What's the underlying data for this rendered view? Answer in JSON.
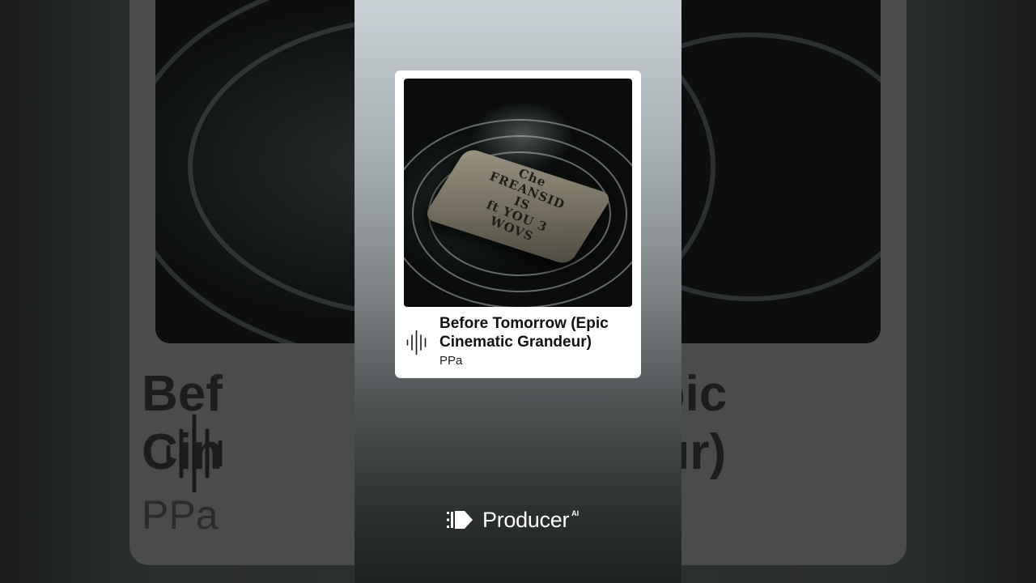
{
  "track": {
    "title": "Before Tomorrow (Epic Cinematic Grandeur)",
    "artist": "PPa",
    "artwork_text": [
      "Che",
      "FREANSID",
      "IS",
      "ft YOU 3",
      "WOVS"
    ]
  },
  "background_copy": {
    "title_line1_left": "Bef",
    "title_line1_right": "v (Epic",
    "title_line2_left": "Cin",
    "title_line2_right": "eur)",
    "artist": "PPa"
  },
  "brand": {
    "name": "Producer",
    "suffix": "AI"
  },
  "colors": {
    "card": "#ffffff",
    "text": "#111111",
    "brand_text": "#ffffff"
  },
  "icons": [
    "audio-wave-icon",
    "producer-logo-icon"
  ]
}
